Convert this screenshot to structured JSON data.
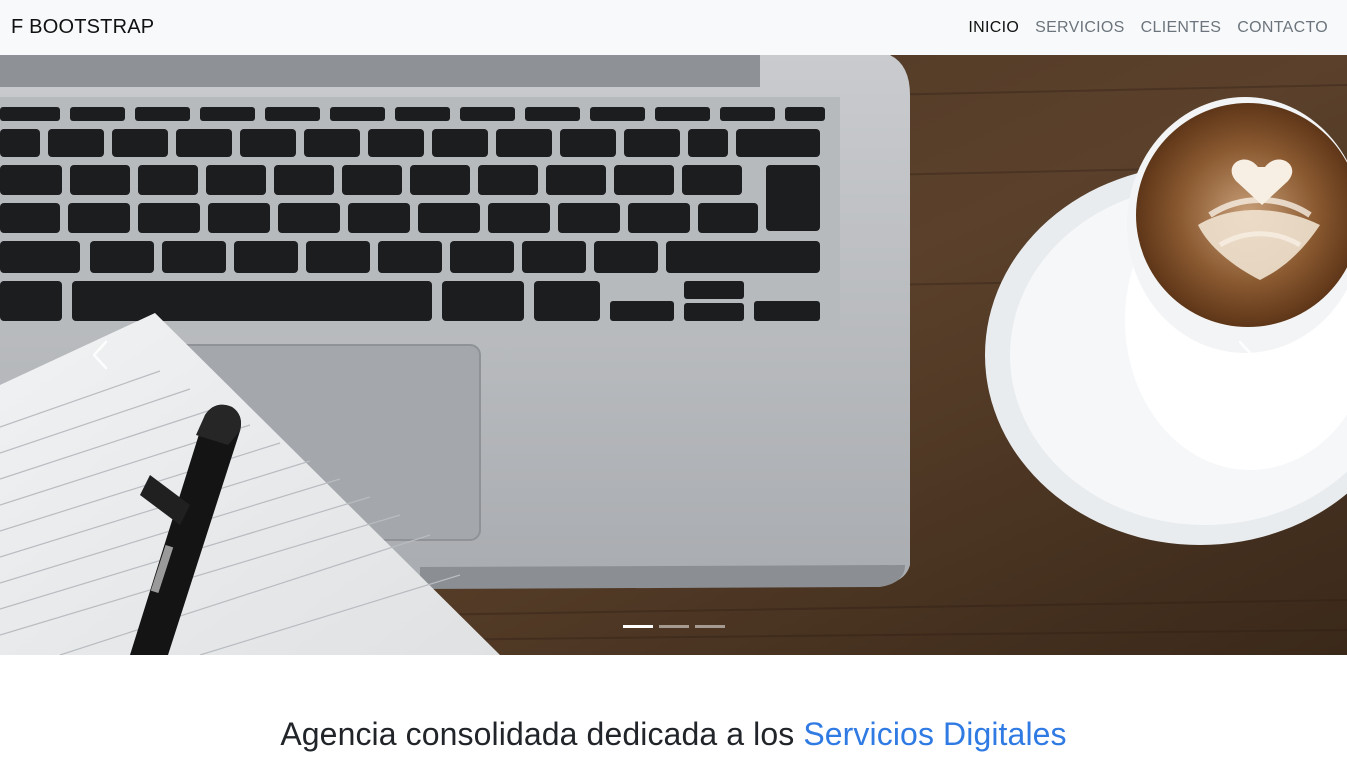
{
  "navbar": {
    "brand": "F BOOTSTRAP",
    "items": [
      {
        "label": "INICIO",
        "active": true
      },
      {
        "label": "SERVICIOS",
        "active": false
      },
      {
        "label": "CLIENTES",
        "active": false
      },
      {
        "label": "CONTACTO",
        "active": false
      }
    ]
  },
  "carousel": {
    "slides": 3,
    "active_slide": 1,
    "prev_icon": "chevron-left-icon",
    "next_icon": "chevron-right-icon",
    "image_description_icon": "laptop-coffee-notebook-photo"
  },
  "hero": {
    "headline_prefix": "Agencia consolidada dedicada a los",
    "headline_accent": "Servicios Digitales"
  },
  "colors": {
    "accent": "#2f7be3",
    "navbar_bg": "#f8f9fa",
    "nav_active": "#111111",
    "nav_inactive": "#6c757d"
  }
}
